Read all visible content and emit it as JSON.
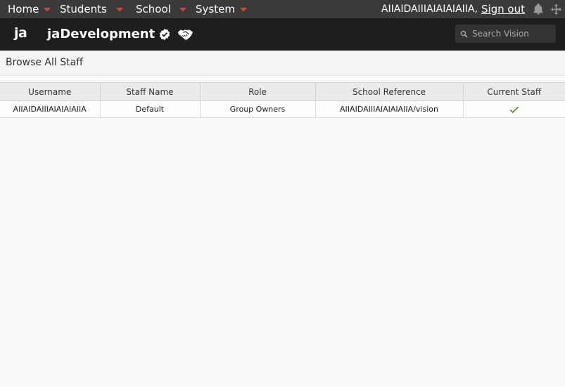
{
  "menu": [
    {
      "label": "Home"
    },
    {
      "label": "Students"
    },
    {
      "label": "School"
    },
    {
      "label": "System"
    }
  ],
  "user": {
    "name": "AIIAIDAIIIAIAIAIAIIA,",
    "signout_label": "Sign out"
  },
  "brand": {
    "logo": "ja",
    "title": "jaDevelopment"
  },
  "search": {
    "placeholder": "Search Vision"
  },
  "page": {
    "title": "Browse All Staff"
  },
  "table": {
    "headers": [
      "Username",
      "Staff Name",
      "Role",
      "School Reference",
      "Current Staff"
    ],
    "rows": [
      {
        "username": "AIIAIDAIIIAIAIAIAIIA",
        "staff_name": "Default",
        "role": "Group Owners",
        "school_reference": "AIIAIDAIIIAIAIAIAIIA/vision",
        "current_staff": true
      }
    ]
  },
  "colors": {
    "menubar": "#3a3a3a",
    "brandbar": "#1e1e1e",
    "caret": "#d9412e",
    "check": "#4a8a3a"
  },
  "icons": [
    "caret-down-icon",
    "bell-icon",
    "move-icon",
    "verified-badge-icon",
    "handshake-icon",
    "search-icon",
    "check-icon"
  ]
}
